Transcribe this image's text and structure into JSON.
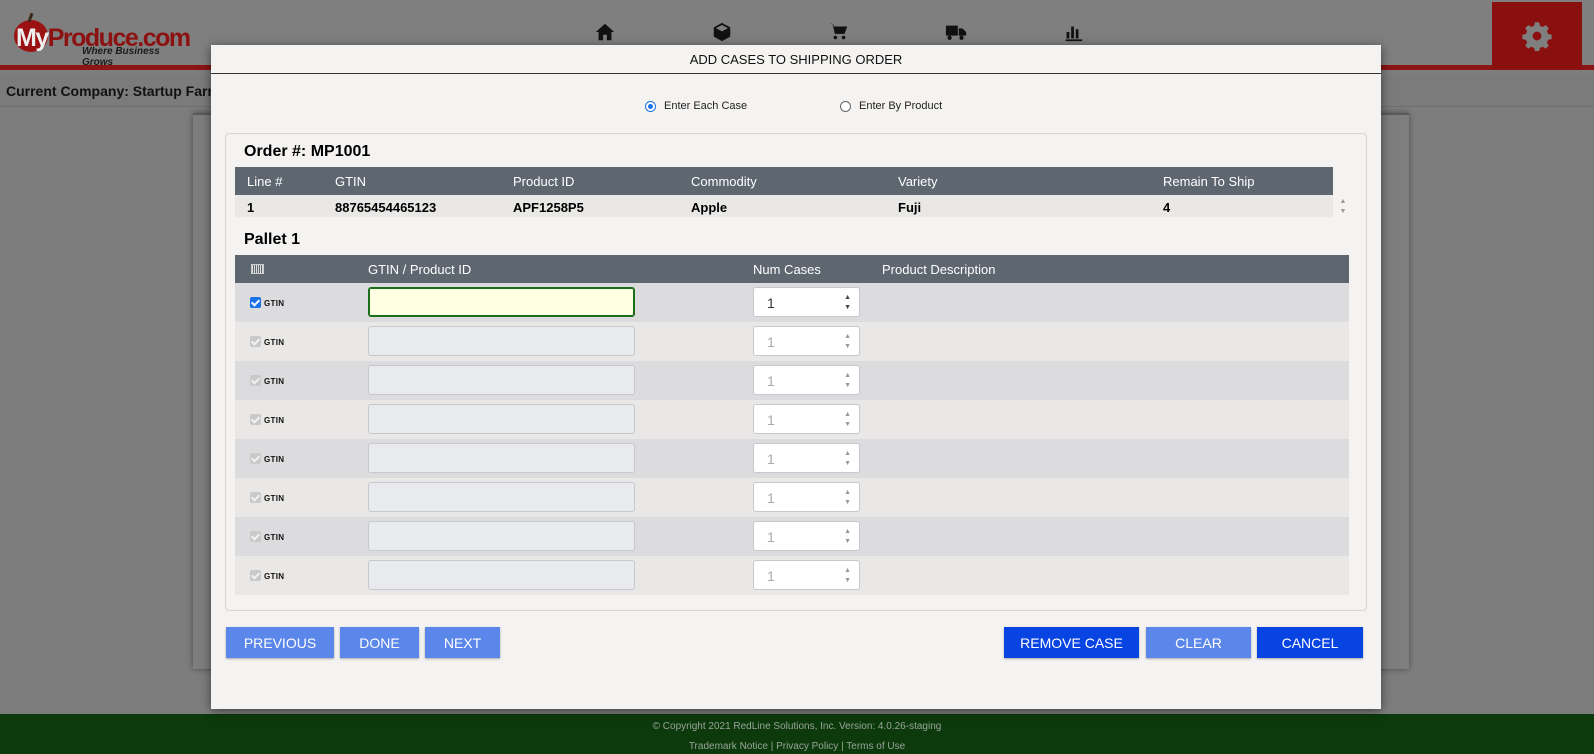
{
  "app": {
    "logo_text_my": "My",
    "logo_text_produce": "Produce.com",
    "logo_tagline": "Where Business Grows",
    "nav_icons": [
      "home-icon",
      "box-icon",
      "cart-icon",
      "truck-icon",
      "chart-icon"
    ],
    "settings_icon": "gear-icon",
    "current_company": "Current Company: Startup Farms"
  },
  "modal": {
    "title": "ADD CASES TO SHIPPING ORDER",
    "radio_each_case": "Enter Each Case",
    "radio_by_product": "Enter By Product",
    "selected_mode": "Enter Each Case"
  },
  "order": {
    "title": "Order #: MP1001",
    "headers": [
      "Line #",
      "GTIN",
      "Product ID",
      "Commodity",
      "Variety",
      "Remain To Ship"
    ],
    "rows": [
      [
        "1",
        "88765454465123",
        "APF1258P5",
        "Apple",
        "Fuji",
        "4"
      ]
    ]
  },
  "pallet": {
    "title": "Pallet 1",
    "headers": {
      "barcode_icon": "barcode-icon",
      "gtin": "GTIN / Product ID",
      "num_cases": "Num Cases",
      "description": "Product Description"
    },
    "rows": [
      {
        "type": "GTIN",
        "gtin": "",
        "num_cases": "1",
        "description": ""
      },
      {
        "type": "GTIN",
        "gtin": "",
        "num_cases": "1",
        "description": ""
      },
      {
        "type": "GTIN",
        "gtin": "",
        "num_cases": "1",
        "description": ""
      },
      {
        "type": "GTIN",
        "gtin": "",
        "num_cases": "1",
        "description": ""
      },
      {
        "type": "GTIN",
        "gtin": "",
        "num_cases": "1",
        "description": ""
      },
      {
        "type": "GTIN",
        "gtin": "",
        "num_cases": "1",
        "description": ""
      },
      {
        "type": "GTIN",
        "gtin": "",
        "num_cases": "1",
        "description": ""
      },
      {
        "type": "GTIN",
        "gtin": "",
        "num_cases": "1",
        "description": ""
      }
    ]
  },
  "buttons": {
    "previous": "PREVIOUS",
    "done": "DONE",
    "next": "NEXT",
    "remove_case": "REMOVE CASE",
    "clear": "CLEAR",
    "cancel": "CANCEL"
  },
  "footer": {
    "copyright": "© Copyright 2021 RedLine Solutions, Inc. Version: 4.0.26-staging",
    "links": "Trademark Notice | Privacy Policy | Terms of Use"
  },
  "colors": {
    "brand_red": "#8c1515",
    "header_blue_gray": "#5e6670",
    "button_light": "#5b86ea",
    "button_strong": "#0844e2",
    "footer_green": "#0c3a0c"
  }
}
